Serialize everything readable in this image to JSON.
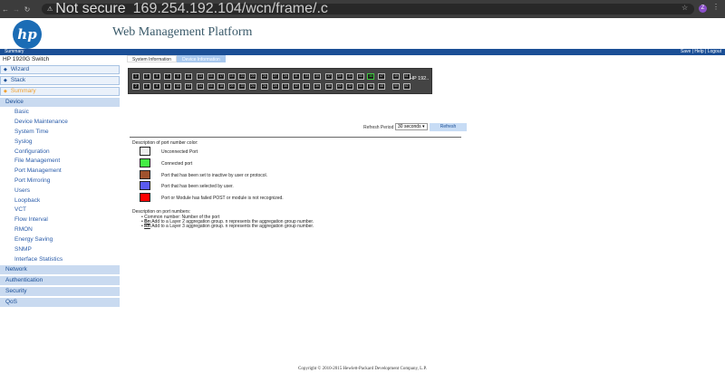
{
  "browser": {
    "back": "←",
    "forward": "→",
    "reload": "↻",
    "not_secure": "Not secure",
    "url": "169.254.192.104/wcn/frame/.c",
    "profile_initial": "Z",
    "star": "☆",
    "menu": "⋮"
  },
  "header": {
    "logo_text": "hp",
    "title": "Web Management Platform",
    "summary": "Summary",
    "links": "Save | Help | Logout"
  },
  "sidebar": {
    "switch_name": "HP 1920G Switch",
    "sections": [
      "Wizard",
      "Stack",
      "Summary"
    ],
    "device": "Device",
    "device_items": [
      "Basic",
      "Device Maintenance",
      "System Time",
      "Syslog",
      "Configuration",
      "File Management",
      "Port Management",
      "Port Mirroring",
      "Users",
      "Loopback",
      "VCT",
      "Flow Interval",
      "RMON",
      "Energy Saving",
      "SNMP",
      "Interface Statistics"
    ],
    "categories": [
      "Network",
      "Authentication",
      "Security",
      "QoS"
    ]
  },
  "tabs": [
    "System Information",
    "Device Information"
  ],
  "panel": {
    "label": "HP 192..",
    "top_ports": [
      "1",
      "3",
      "5",
      "7",
      "9",
      "11",
      "13",
      "15",
      "17",
      "19",
      "21",
      "23",
      "25",
      "27",
      "29",
      "31",
      "33",
      "35",
      "37",
      "39",
      "41",
      "43",
      "45",
      "47",
      "49",
      "51"
    ],
    "bottom_ports": [
      "2",
      "4",
      "6",
      "8",
      "10",
      "12",
      "14",
      "16",
      "18",
      "20",
      "22",
      "24",
      "26",
      "28",
      "30",
      "32",
      "34",
      "36",
      "38",
      "40",
      "42",
      "44",
      "46",
      "48",
      "50",
      "52"
    ],
    "connected_port": "45"
  },
  "refresh": {
    "label": "Refresh Period",
    "period": "30 seconds",
    "button": "Refresh"
  },
  "legend": {
    "title": "Description of port number color:",
    "items": [
      {
        "color": "#f0f0f0",
        "text": "Unconnected Port"
      },
      {
        "color": "#44ee44",
        "text": "Connected port"
      },
      {
        "color": "#a0522d",
        "text": "Port that has been set to inactive by user or protocol."
      },
      {
        "color": "#5b5bf0",
        "text": "Port that has been selected by user."
      },
      {
        "color": "#ff0000",
        "text": "Port or Module has failed POST or module is not recognized."
      }
    ]
  },
  "numbers": {
    "title": "Description on port numbers:",
    "items": [
      {
        "bold": "",
        "text": "Common number: Number of the port"
      },
      {
        "bold": "Bn",
        "text": ":Add to a Layer 2 aggregation group. n represents the aggregation group number."
      },
      {
        "bold": "Rn",
        "text": ":Add to a Layer 3 aggregation group. n represents the aggregation group number."
      }
    ]
  },
  "footer": "Copyright © 2010-2015 Hewlett-Packard Development Company, L.P."
}
